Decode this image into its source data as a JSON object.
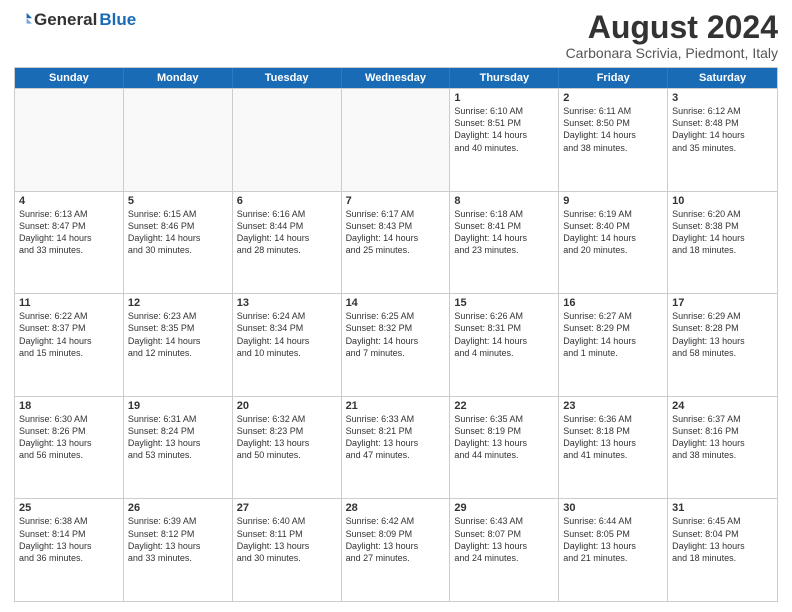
{
  "logo": {
    "general": "General",
    "blue": "Blue"
  },
  "title": "August 2024",
  "location": "Carbonara Scrivia, Piedmont, Italy",
  "days": [
    "Sunday",
    "Monday",
    "Tuesday",
    "Wednesday",
    "Thursday",
    "Friday",
    "Saturday"
  ],
  "weeks": [
    [
      {
        "day": "",
        "content": ""
      },
      {
        "day": "",
        "content": ""
      },
      {
        "day": "",
        "content": ""
      },
      {
        "day": "",
        "content": ""
      },
      {
        "day": "1",
        "content": "Sunrise: 6:10 AM\nSunset: 8:51 PM\nDaylight: 14 hours\nand 40 minutes."
      },
      {
        "day": "2",
        "content": "Sunrise: 6:11 AM\nSunset: 8:50 PM\nDaylight: 14 hours\nand 38 minutes."
      },
      {
        "day": "3",
        "content": "Sunrise: 6:12 AM\nSunset: 8:48 PM\nDaylight: 14 hours\nand 35 minutes."
      }
    ],
    [
      {
        "day": "4",
        "content": "Sunrise: 6:13 AM\nSunset: 8:47 PM\nDaylight: 14 hours\nand 33 minutes."
      },
      {
        "day": "5",
        "content": "Sunrise: 6:15 AM\nSunset: 8:46 PM\nDaylight: 14 hours\nand 30 minutes."
      },
      {
        "day": "6",
        "content": "Sunrise: 6:16 AM\nSunset: 8:44 PM\nDaylight: 14 hours\nand 28 minutes."
      },
      {
        "day": "7",
        "content": "Sunrise: 6:17 AM\nSunset: 8:43 PM\nDaylight: 14 hours\nand 25 minutes."
      },
      {
        "day": "8",
        "content": "Sunrise: 6:18 AM\nSunset: 8:41 PM\nDaylight: 14 hours\nand 23 minutes."
      },
      {
        "day": "9",
        "content": "Sunrise: 6:19 AM\nSunset: 8:40 PM\nDaylight: 14 hours\nand 20 minutes."
      },
      {
        "day": "10",
        "content": "Sunrise: 6:20 AM\nSunset: 8:38 PM\nDaylight: 14 hours\nand 18 minutes."
      }
    ],
    [
      {
        "day": "11",
        "content": "Sunrise: 6:22 AM\nSunset: 8:37 PM\nDaylight: 14 hours\nand 15 minutes."
      },
      {
        "day": "12",
        "content": "Sunrise: 6:23 AM\nSunset: 8:35 PM\nDaylight: 14 hours\nand 12 minutes."
      },
      {
        "day": "13",
        "content": "Sunrise: 6:24 AM\nSunset: 8:34 PM\nDaylight: 14 hours\nand 10 minutes."
      },
      {
        "day": "14",
        "content": "Sunrise: 6:25 AM\nSunset: 8:32 PM\nDaylight: 14 hours\nand 7 minutes."
      },
      {
        "day": "15",
        "content": "Sunrise: 6:26 AM\nSunset: 8:31 PM\nDaylight: 14 hours\nand 4 minutes."
      },
      {
        "day": "16",
        "content": "Sunrise: 6:27 AM\nSunset: 8:29 PM\nDaylight: 14 hours\nand 1 minute."
      },
      {
        "day": "17",
        "content": "Sunrise: 6:29 AM\nSunset: 8:28 PM\nDaylight: 13 hours\nand 58 minutes."
      }
    ],
    [
      {
        "day": "18",
        "content": "Sunrise: 6:30 AM\nSunset: 8:26 PM\nDaylight: 13 hours\nand 56 minutes."
      },
      {
        "day": "19",
        "content": "Sunrise: 6:31 AM\nSunset: 8:24 PM\nDaylight: 13 hours\nand 53 minutes."
      },
      {
        "day": "20",
        "content": "Sunrise: 6:32 AM\nSunset: 8:23 PM\nDaylight: 13 hours\nand 50 minutes."
      },
      {
        "day": "21",
        "content": "Sunrise: 6:33 AM\nSunset: 8:21 PM\nDaylight: 13 hours\nand 47 minutes."
      },
      {
        "day": "22",
        "content": "Sunrise: 6:35 AM\nSunset: 8:19 PM\nDaylight: 13 hours\nand 44 minutes."
      },
      {
        "day": "23",
        "content": "Sunrise: 6:36 AM\nSunset: 8:18 PM\nDaylight: 13 hours\nand 41 minutes."
      },
      {
        "day": "24",
        "content": "Sunrise: 6:37 AM\nSunset: 8:16 PM\nDaylight: 13 hours\nand 38 minutes."
      }
    ],
    [
      {
        "day": "25",
        "content": "Sunrise: 6:38 AM\nSunset: 8:14 PM\nDaylight: 13 hours\nand 36 minutes."
      },
      {
        "day": "26",
        "content": "Sunrise: 6:39 AM\nSunset: 8:12 PM\nDaylight: 13 hours\nand 33 minutes."
      },
      {
        "day": "27",
        "content": "Sunrise: 6:40 AM\nSunset: 8:11 PM\nDaylight: 13 hours\nand 30 minutes."
      },
      {
        "day": "28",
        "content": "Sunrise: 6:42 AM\nSunset: 8:09 PM\nDaylight: 13 hours\nand 27 minutes."
      },
      {
        "day": "29",
        "content": "Sunrise: 6:43 AM\nSunset: 8:07 PM\nDaylight: 13 hours\nand 24 minutes."
      },
      {
        "day": "30",
        "content": "Sunrise: 6:44 AM\nSunset: 8:05 PM\nDaylight: 13 hours\nand 21 minutes."
      },
      {
        "day": "31",
        "content": "Sunrise: 6:45 AM\nSunset: 8:04 PM\nDaylight: 13 hours\nand 18 minutes."
      }
    ]
  ]
}
